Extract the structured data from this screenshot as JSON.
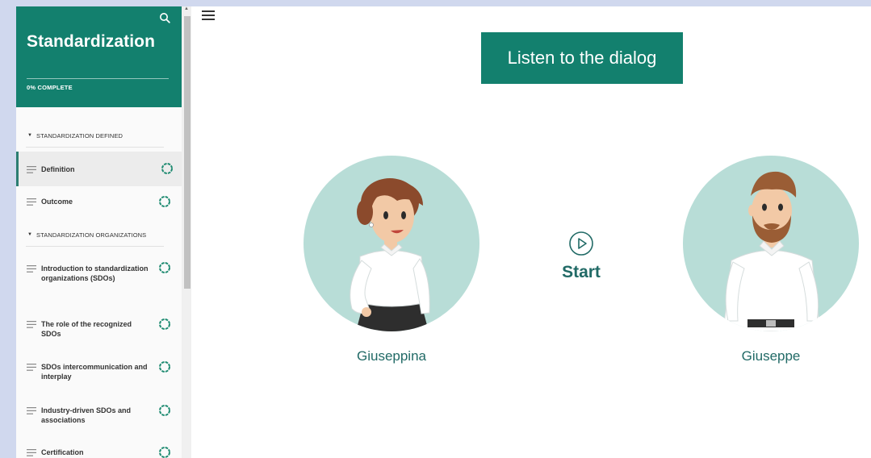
{
  "sidebar": {
    "title": "Standardization",
    "progress": "0% COMPLETE",
    "sections": [
      {
        "label": "STANDARDIZATION DEFINED"
      },
      {
        "label": "STANDARDIZATION ORGANIZATIONS"
      }
    ],
    "items": [
      {
        "label": "Definition",
        "active": true
      },
      {
        "label": "Outcome"
      },
      {
        "label": "Introduction to standardization organizations (SDOs)"
      },
      {
        "label": "The role of the recognized SDOs"
      },
      {
        "label": "SDOs intercommunication and interplay"
      },
      {
        "label": "Industry-driven SDOs and associations"
      },
      {
        "label": "Certification"
      }
    ]
  },
  "main": {
    "listen_button": "Listen to the dialog",
    "start_label": "Start",
    "characters": [
      {
        "name": "Giuseppina"
      },
      {
        "name": "Giuseppe"
      }
    ]
  },
  "colors": {
    "primary": "#13806e",
    "text_accent": "#216a66",
    "avatar_bg": "#b8ddd7"
  }
}
